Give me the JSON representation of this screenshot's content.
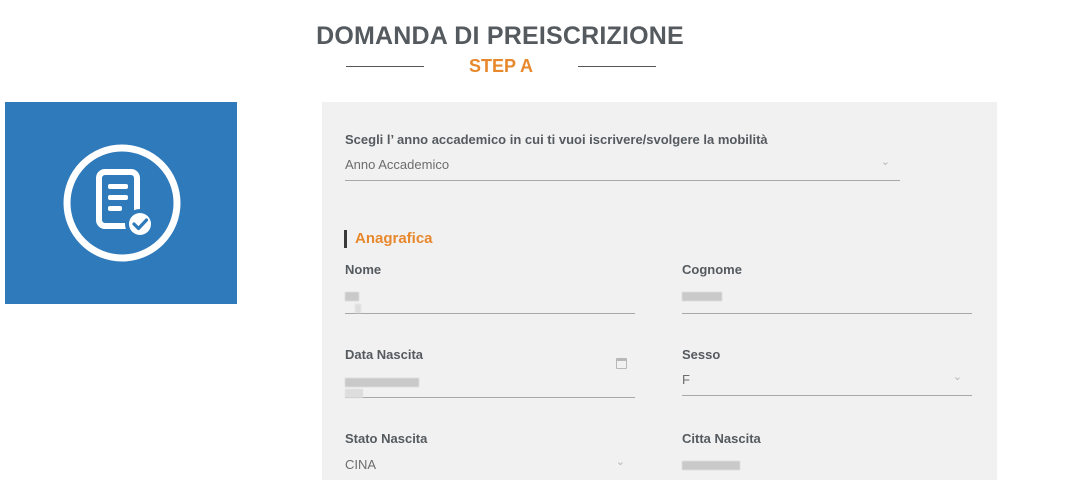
{
  "header": {
    "title": "DOMANDA DI PREISCRIZIONE",
    "step": "STEP A"
  },
  "icon_tile": {
    "icon": "document-check-icon",
    "color": "#2f7abb"
  },
  "form": {
    "academic_year": {
      "label": "Scegli l’ anno accademico in cui ti vuoi iscrivere/svolgere la mobilità",
      "placeholder": "Anno Accademico"
    },
    "section_title": "Anagrafica",
    "nome": {
      "label": "Nome"
    },
    "cognome": {
      "label": "Cognome"
    },
    "data_nascita": {
      "label": "Data Nascita",
      "icon": "calendar-icon"
    },
    "sesso": {
      "label": "Sesso",
      "value": "F"
    },
    "stato_nascita": {
      "label": "Stato Nascita",
      "value": "CINA"
    },
    "citta_nascita": {
      "label": "Citta Nascita"
    }
  },
  "colors": {
    "accent": "#e8882d",
    "panel_bg": "#f1f1f1",
    "heading": "#555a5f"
  }
}
